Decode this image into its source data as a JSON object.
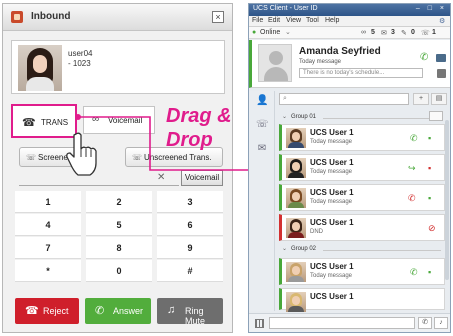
{
  "inbound": {
    "title": "Inbound",
    "caller_name": "user04",
    "caller_number": "- 1023",
    "trans_label": "TRANS",
    "voicemail_label": "Voicemail",
    "screened_label": "Screened",
    "unscreened_label": "Unscreened Trans.",
    "dial_value": "",
    "vm_small_label": "Voicemail",
    "keypad": [
      "1",
      "2",
      "3",
      "4",
      "5",
      "6",
      "7",
      "8",
      "9",
      "*",
      "0",
      "#"
    ],
    "reject_label": "Reject",
    "answer_label": "Answer",
    "ringmute_label": "Ring Mute"
  },
  "overlay": {
    "drag_text_1": "Drag &",
    "drag_text_2": "Drop",
    "accent_color": "#e01c8c"
  },
  "ucs": {
    "title": "UCS Client - User ID",
    "menu": [
      "File",
      "Edit",
      "View",
      "Tool",
      "Help"
    ],
    "status": "Online",
    "counts": [
      "5",
      "3",
      "0",
      "1"
    ],
    "profile_name": "Amanda Seyfried",
    "profile_message": "Today message",
    "profile_schedule_placeholder": "There is no today's schedule...",
    "search_value": "",
    "group1": "Group 01",
    "group2": "Group 02",
    "users": [
      {
        "name": "UCS User 1",
        "message": "Today message"
      },
      {
        "name": "UCS User 1",
        "message": "Today message"
      },
      {
        "name": "UCS User 1",
        "message": "Today message"
      },
      {
        "name": "UCS User 1",
        "message": "DND"
      },
      {
        "name": "UCS User 1",
        "message": "Today message"
      },
      {
        "name": "UCS User 1",
        "message": ""
      }
    ],
    "colors": {
      "online": "#49a83a",
      "dnd": "#d23030",
      "titlebar": "#2d5488"
    }
  }
}
